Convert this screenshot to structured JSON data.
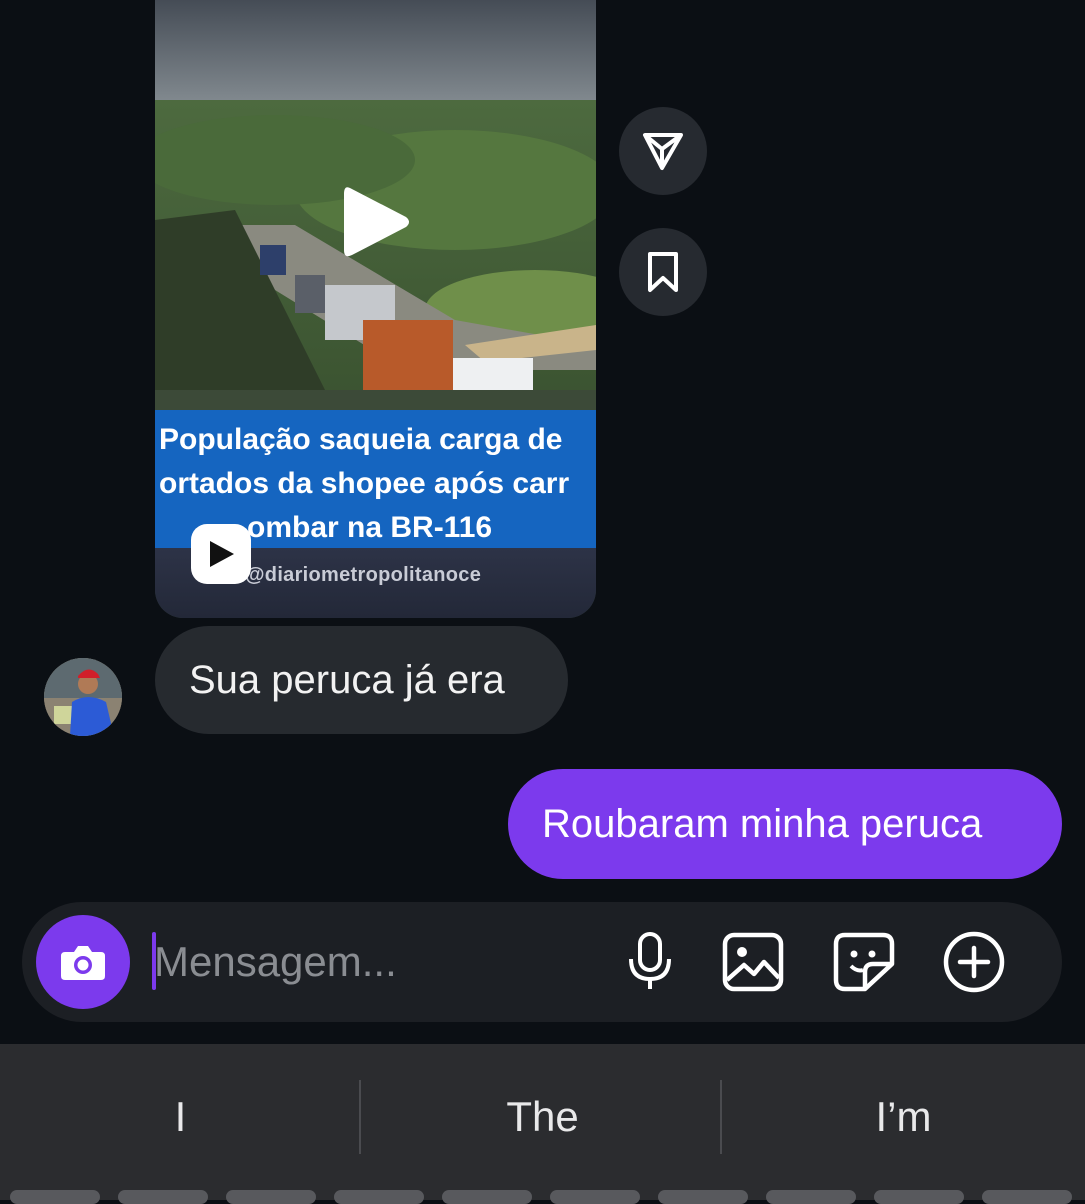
{
  "reel": {
    "caption_lines": [
      "População saqueia carga de",
      "ortados da shopee após carr",
      "ombar na BR-116"
    ],
    "handle": "@diariometropolitanoce"
  },
  "actions": {
    "share_icon": "send-icon",
    "save_icon": "bookmark-icon"
  },
  "messages": [
    {
      "direction": "incoming",
      "text": "Sua peruca já era"
    },
    {
      "direction": "outgoing",
      "text": "Roubaram minha peruca"
    }
  ],
  "composer": {
    "placeholder": "Mensagem...",
    "value": "",
    "icons": [
      "camera-icon",
      "microphone-icon",
      "gallery-icon",
      "sticker-icon",
      "plus-icon"
    ]
  },
  "keyboard": {
    "suggestions": [
      "I",
      "The",
      "I’m"
    ]
  },
  "colors": {
    "accent": "#7c3aed",
    "background": "#0b0f14",
    "incoming_bubble": "#262a2f",
    "caption_bar": "#1565c0"
  }
}
